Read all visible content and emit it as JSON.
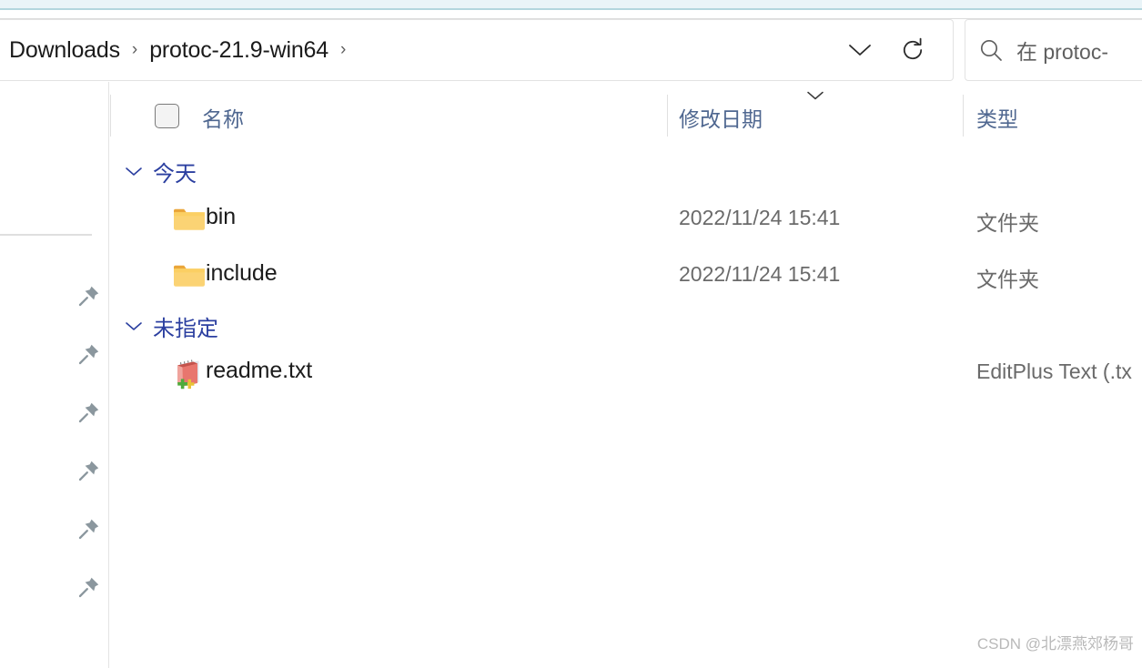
{
  "window": {
    "accent_color": "#b2d6de"
  },
  "addressbar": {
    "crumbs": [
      {
        "label": "Downloads"
      },
      {
        "label": "protoc-21.9-win64"
      }
    ],
    "separator": "›",
    "history_dropdown_icon": "chevron-down-icon",
    "refresh_icon": "refresh-icon"
  },
  "search": {
    "icon": "search-icon",
    "value": "在 protoc-"
  },
  "navpane": {
    "pins": [
      {
        "icon": "pin-icon"
      },
      {
        "icon": "pin-icon"
      },
      {
        "icon": "pin-icon"
      },
      {
        "icon": "pin-icon"
      },
      {
        "icon": "pin-icon"
      },
      {
        "icon": "pin-icon"
      }
    ]
  },
  "filelist": {
    "select_all_checkbox": {
      "checked": false
    },
    "columns": [
      {
        "label": "名称",
        "sorted": false
      },
      {
        "label": "修改日期",
        "sorted": true,
        "sort_icon": "chevron-down-icon"
      },
      {
        "label": "类型",
        "sorted": false
      }
    ],
    "groups": [
      {
        "label": "今天",
        "expanded": true,
        "chevron_icon": "chevron-down-icon",
        "rows": [
          {
            "icon": "folder-icon",
            "name": "bin",
            "date": "2022/11/24 15:41",
            "type": "文件夹"
          },
          {
            "icon": "folder-icon",
            "name": "include",
            "date": "2022/11/24 15:41",
            "type": "文件夹"
          }
        ]
      },
      {
        "label": "未指定",
        "expanded": true,
        "chevron_icon": "chevron-down-icon",
        "rows": [
          {
            "icon": "editplus-text-file-icon",
            "name": "readme.txt",
            "date": "",
            "type": "EditPlus Text (.tx"
          }
        ]
      }
    ]
  },
  "watermark": {
    "text": "CSDN @北漂燕郊杨哥"
  }
}
